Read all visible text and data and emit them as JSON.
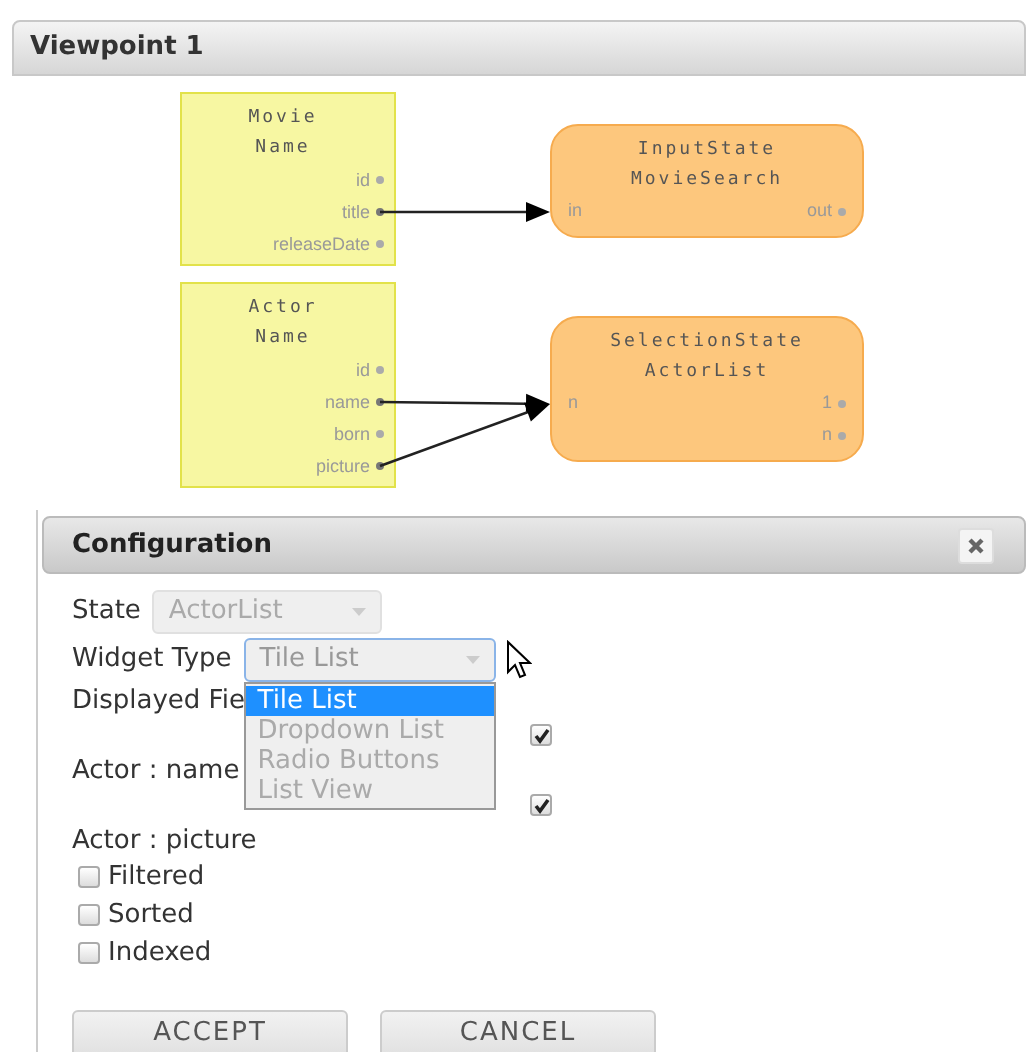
{
  "viewpoint": {
    "title": "Viewpoint 1"
  },
  "diagram": {
    "entities": [
      {
        "title": "Movie",
        "subtitle": "Name",
        "fields": [
          {
            "label": "id",
            "connected": false
          },
          {
            "label": "title",
            "connected": true
          },
          {
            "label": "releaseDate",
            "connected": false
          }
        ]
      },
      {
        "title": "Actor",
        "subtitle": "Name",
        "fields": [
          {
            "label": "id",
            "connected": false
          },
          {
            "label": "name",
            "connected": true
          },
          {
            "label": "born",
            "connected": false
          },
          {
            "label": "picture",
            "connected": true
          }
        ]
      }
    ],
    "states": [
      {
        "type": "InputState",
        "name": "MovieSearch",
        "inputs": [
          "in"
        ],
        "outputs": [
          "out"
        ]
      },
      {
        "type": "SelectionState",
        "name": "ActorList",
        "inputs": [
          "n"
        ],
        "outputs": [
          "1",
          "n"
        ]
      }
    ]
  },
  "dialog": {
    "title": "Configuration",
    "state": {
      "label": "State",
      "value": "ActorList",
      "disabled": true
    },
    "widget_type": {
      "label": "Widget Type",
      "value": "Tile List",
      "expanded": true,
      "options": [
        {
          "label": "Tile List",
          "selected": true
        },
        {
          "label": "Dropdown List",
          "selected": false
        },
        {
          "label": "Radio Buttons",
          "selected": false
        },
        {
          "label": "List View",
          "selected": false
        }
      ]
    },
    "items": [
      {
        "kind": "label",
        "text": "Displayed Fie"
      },
      {
        "kind": "check",
        "checked": true
      },
      {
        "kind": "label",
        "text": "Actor : name"
      },
      {
        "kind": "check",
        "checked": true
      },
      {
        "kind": "label",
        "text": "Actor : picture"
      },
      {
        "kind": "option",
        "text": "Filtered",
        "checked": false
      },
      {
        "kind": "option",
        "text": "Sorted",
        "checked": false
      },
      {
        "kind": "option",
        "text": "Indexed",
        "checked": false
      }
    ],
    "buttons": [
      "ACCEPT",
      "CANCEL"
    ]
  }
}
